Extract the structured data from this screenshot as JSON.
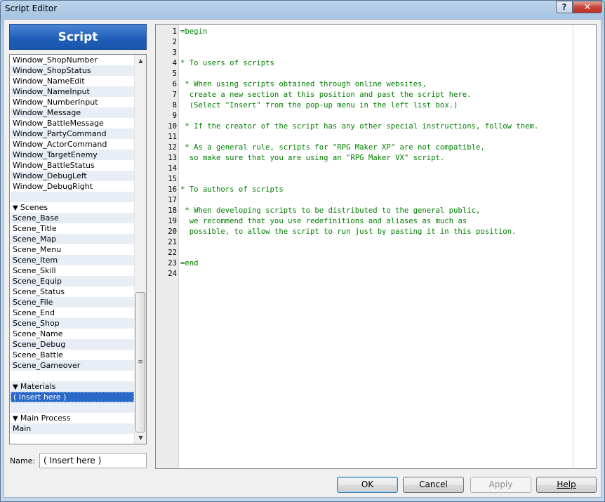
{
  "window": {
    "title": "Script Editor",
    "help_glyph": "?",
    "close_glyph": "✕"
  },
  "left_panel": {
    "header": "Script",
    "items": [
      {
        "label": "Window_ShopNumber",
        "kind": "item"
      },
      {
        "label": "Window_ShopStatus",
        "kind": "item"
      },
      {
        "label": "Window_NameEdit",
        "kind": "item"
      },
      {
        "label": "Window_NameInput",
        "kind": "item"
      },
      {
        "label": "Window_NumberInput",
        "kind": "item"
      },
      {
        "label": "Window_Message",
        "kind": "item"
      },
      {
        "label": "Window_BattleMessage",
        "kind": "item"
      },
      {
        "label": "Window_PartyCommand",
        "kind": "item"
      },
      {
        "label": "Window_ActorCommand",
        "kind": "item"
      },
      {
        "label": "Window_TargetEnemy",
        "kind": "item"
      },
      {
        "label": "Window_BattleStatus",
        "kind": "item"
      },
      {
        "label": "Window_DebugLeft",
        "kind": "item"
      },
      {
        "label": "Window_DebugRight",
        "kind": "item"
      },
      {
        "label": "",
        "kind": "blank"
      },
      {
        "label": "Scenes",
        "kind": "section"
      },
      {
        "label": "Scene_Base",
        "kind": "item"
      },
      {
        "label": "Scene_Title",
        "kind": "item"
      },
      {
        "label": "Scene_Map",
        "kind": "item"
      },
      {
        "label": "Scene_Menu",
        "kind": "item"
      },
      {
        "label": "Scene_Item",
        "kind": "item"
      },
      {
        "label": "Scene_Skill",
        "kind": "item"
      },
      {
        "label": "Scene_Equip",
        "kind": "item"
      },
      {
        "label": "Scene_Status",
        "kind": "item"
      },
      {
        "label": "Scene_File",
        "kind": "item"
      },
      {
        "label": "Scene_End",
        "kind": "item"
      },
      {
        "label": "Scene_Shop",
        "kind": "item"
      },
      {
        "label": "Scene_Name",
        "kind": "item"
      },
      {
        "label": "Scene_Debug",
        "kind": "item"
      },
      {
        "label": "Scene_Battle",
        "kind": "item"
      },
      {
        "label": "Scene_Gameover",
        "kind": "item"
      },
      {
        "label": "",
        "kind": "blank"
      },
      {
        "label": "Materials",
        "kind": "section"
      },
      {
        "label": "( Insert here )",
        "kind": "selected"
      },
      {
        "label": "",
        "kind": "blank"
      },
      {
        "label": "Main Process",
        "kind": "section"
      },
      {
        "label": "Main",
        "kind": "item"
      },
      {
        "label": "",
        "kind": "blank"
      }
    ],
    "name_label": "Name:",
    "name_value": "( Insert here )"
  },
  "editor": {
    "lines": [
      "=begin",
      "",
      "",
      "* To users of scripts",
      "",
      " * When using scripts obtained through online websites,",
      "  create a new section at this position and past the script here.",
      "  (Select \"Insert\" from the pop-up menu in the left list box.)",
      "",
      " * If the creator of the script has any other special instructions, follow them.",
      "",
      " * As a general rule, scripts for \"RPG Maker XP\" are not compatible,",
      "  so make sure that you are using an \"RPG Maker VX\" script.",
      "",
      "",
      "* To authors of scripts",
      "",
      " * When developing scripts to be distributed to the general public,",
      "  we recommend that you use redefinitions and aliases as much as",
      "  possible, to allow the script to run just by pasting it in this position.",
      "",
      "",
      "=end",
      ""
    ]
  },
  "buttons": {
    "ok": "OK",
    "cancel": "Cancel",
    "apply": "Apply",
    "help": "Help"
  },
  "colors": {
    "header_blue": "#1f5db8",
    "comment_green": "#008000",
    "selection_blue": "#2a69c8"
  }
}
